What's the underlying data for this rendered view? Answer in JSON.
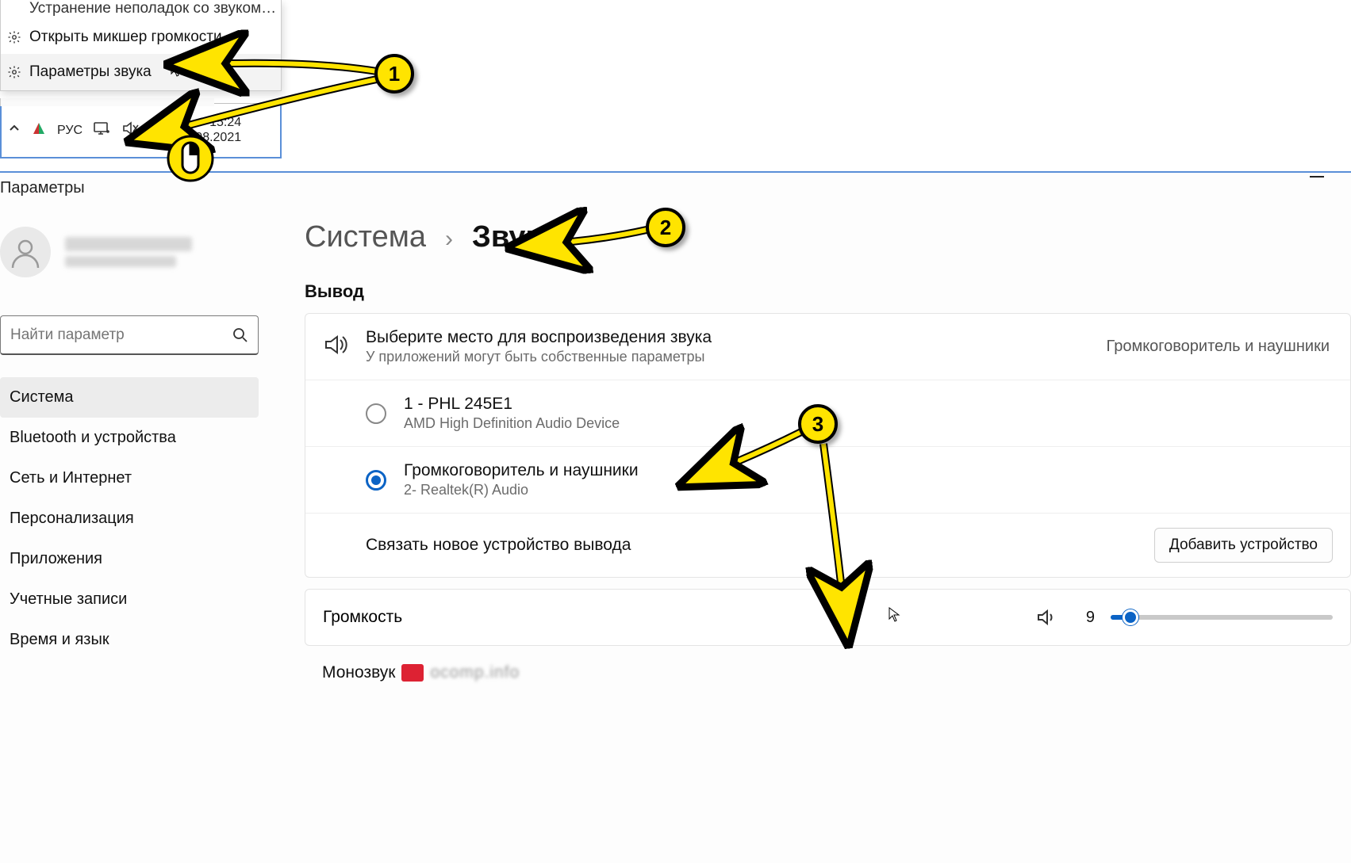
{
  "contextMenu": {
    "cutItem": "Устранение неполадок со звуком…",
    "items": [
      {
        "label": "Открыть микшер громкости",
        "hasGear": true
      },
      {
        "label": "Параметры звука",
        "hasGear": true
      }
    ]
  },
  "taskbar": {
    "lang": "РУС",
    "time": "15:24",
    "date": "29.08.2021"
  },
  "settings": {
    "windowTitle": "Параметры",
    "searchPlaceholder": "Найти параметр",
    "nav": [
      "Система",
      "Bluetooth и устройства",
      "Сеть и Интернет",
      "Персонализация",
      "Приложения",
      "Учетные записи",
      "Время и язык"
    ],
    "breadcrumb": {
      "root": "Система",
      "current": "Звук"
    },
    "sectionOutput": "Вывод",
    "outputHeader": {
      "title": "Выберите место для воспроизведения звука",
      "sub": "У приложений могут быть собственные параметры",
      "value": "Громкоговоритель и наушники"
    },
    "devices": [
      {
        "name": "1 - PHL 245E1",
        "sub": "AMD High Definition Audio Device",
        "selected": false
      },
      {
        "name": "Громкоговоритель и наушники",
        "sub": "2- Realtek(R) Audio",
        "selected": true
      }
    ],
    "pair": {
      "label": "Связать новое устройство вывода",
      "button": "Добавить устройство"
    },
    "volume": {
      "label": "Громкость",
      "value": 9,
      "max": 100
    },
    "mono": {
      "label": "Монозвук",
      "obscured": "ocomp.info"
    }
  },
  "annotations": {
    "b1": "1",
    "b2": "2",
    "b3": "3"
  }
}
